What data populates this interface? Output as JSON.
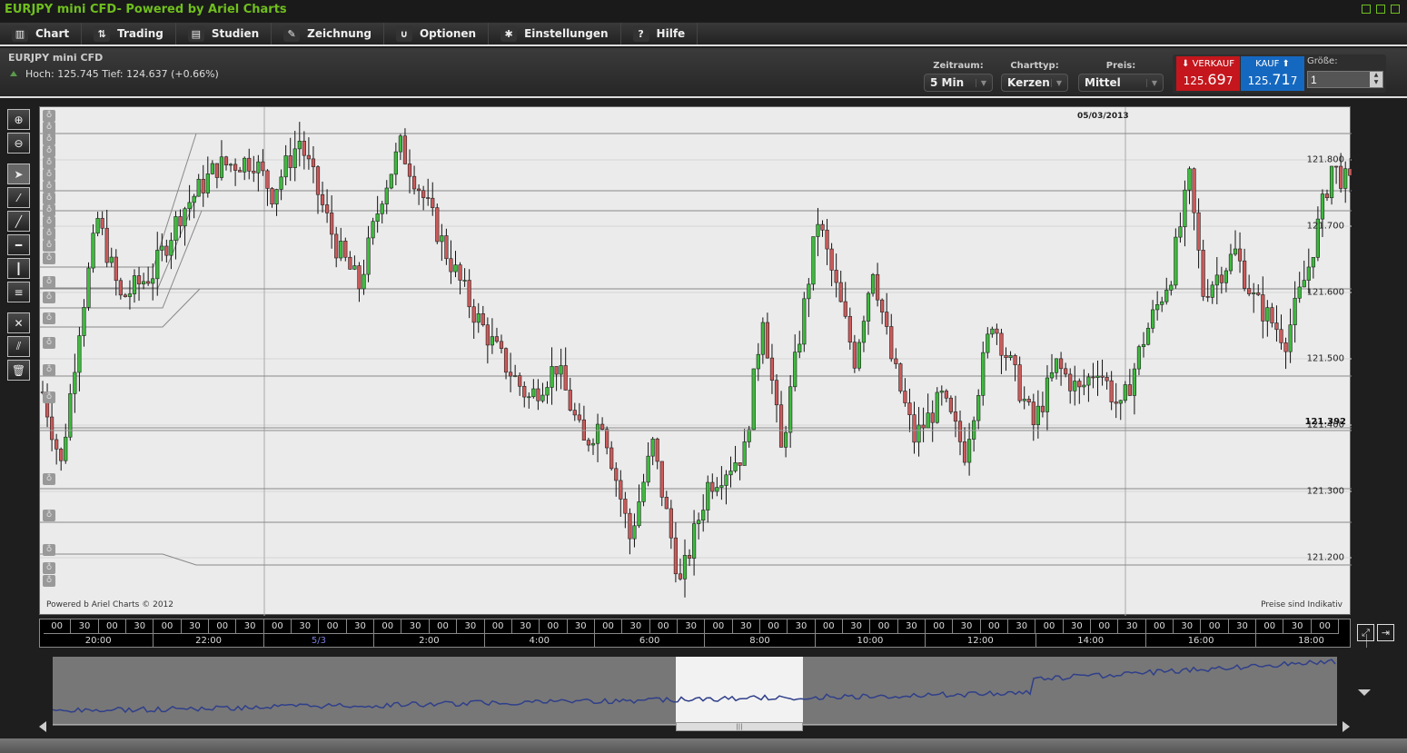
{
  "window": {
    "title": "EURJPY mini  CFD- Powered by Ariel Charts"
  },
  "menu": [
    {
      "label": "Chart",
      "icon": "bar-chart-icon",
      "glyph": "▥"
    },
    {
      "label": "Trading",
      "icon": "trade-arrows-icon",
      "glyph": "⇅"
    },
    {
      "label": "Studien",
      "icon": "studies-icon",
      "glyph": "▤"
    },
    {
      "label": "Zeichnung",
      "icon": "pencil-icon",
      "glyph": "✎"
    },
    {
      "label": "Optionen",
      "icon": "options-curve-icon",
      "glyph": "∪"
    },
    {
      "label": "Einstellungen",
      "icon": "tools-icon",
      "glyph": "✱"
    },
    {
      "label": "Hilfe",
      "icon": "help-icon",
      "glyph": "?"
    }
  ],
  "instrument": {
    "name": "EURJPY mini  CFD",
    "stats": "Hoch: 125.745 Tief: 124.637 (+0.66%)"
  },
  "controls": {
    "zeitraum": {
      "label": "Zeitraum:",
      "value": "5 Min"
    },
    "charttyp": {
      "label": "Charttyp:",
      "value": "Kerzen"
    },
    "preis": {
      "label": "Preis:",
      "value": "Mittel"
    }
  },
  "trade": {
    "sell_label": "VERKAUF",
    "sell_price_prefix": "125.",
    "sell_price_big": "69",
    "sell_price_suffix": "7",
    "buy_label": "KAUF",
    "buy_price_prefix": "125.",
    "buy_price_big": "71",
    "buy_price_suffix": "7",
    "size_label": "Größe:",
    "size_value": "1"
  },
  "colors": {
    "up": "#3dbb3d",
    "down": "#cc5a5a",
    "sell": "#c4161c",
    "buy": "#1568c0",
    "title": "#6fbf1e"
  },
  "chart": {
    "date_label": "05/03/2013",
    "current_price": "121.392",
    "price_labels": [
      "121.800",
      "121.700",
      "121.600",
      "121.500",
      "121.400",
      "121.300",
      "121.200"
    ],
    "powered": "Powered b Ariel Charts © 2012",
    "disclaimer": "Preise sind Indikativ",
    "price_path": [
      [
        0,
        121.45
      ],
      [
        4,
        121.34
      ],
      [
        8,
        121.55
      ],
      [
        12,
        121.71
      ],
      [
        17,
        121.59
      ],
      [
        24,
        121.63
      ],
      [
        30,
        121.72
      ],
      [
        38,
        121.79
      ],
      [
        46,
        121.8
      ],
      [
        50,
        121.75
      ],
      [
        56,
        121.83
      ],
      [
        64,
        121.67
      ],
      [
        69,
        121.61
      ],
      [
        74,
        121.75
      ],
      [
        78,
        121.82
      ],
      [
        82,
        121.76
      ],
      [
        88,
        121.66
      ],
      [
        94,
        121.57
      ],
      [
        100,
        121.5
      ],
      [
        106,
        121.44
      ],
      [
        112,
        121.49
      ],
      [
        118,
        121.37
      ],
      [
        122,
        121.41
      ],
      [
        128,
        121.23
      ],
      [
        133,
        121.37
      ],
      [
        139,
        121.16
      ],
      [
        145,
        121.31
      ],
      [
        153,
        121.36
      ],
      [
        157,
        121.57
      ],
      [
        161,
        121.36
      ],
      [
        169,
        121.71
      ],
      [
        177,
        121.5
      ],
      [
        181,
        121.64
      ],
      [
        185,
        121.5
      ],
      [
        190,
        121.38
      ],
      [
        196,
        121.44
      ],
      [
        201,
        121.36
      ],
      [
        207,
        121.56
      ],
      [
        211,
        121.49
      ],
      [
        216,
        121.4
      ],
      [
        221,
        121.49
      ],
      [
        226,
        121.45
      ],
      [
        230,
        121.49
      ],
      [
        235,
        121.42
      ],
      [
        240,
        121.53
      ],
      [
        246,
        121.63
      ],
      [
        250,
        121.77
      ],
      [
        253,
        121.6
      ],
      [
        260,
        121.66
      ],
      [
        264,
        121.59
      ],
      [
        271,
        121.53
      ],
      [
        276,
        121.64
      ],
      [
        281,
        121.79
      ],
      [
        285,
        121.76
      ]
    ]
  },
  "time_axis": {
    "minor": [
      "00",
      "30",
      "00",
      "30",
      "00",
      "30",
      "00",
      "30",
      "00",
      "30",
      "00",
      "30",
      "00",
      "30",
      "00",
      "30",
      "00",
      "30",
      "00",
      "30",
      "00",
      "30",
      "00",
      "30",
      "00",
      "30",
      "00",
      "30",
      "00",
      "30",
      "00",
      "30",
      "00",
      "30",
      "00",
      "30",
      "00",
      "30",
      "00",
      "30",
      "00",
      "30",
      "00",
      "30",
      "00",
      "30",
      "00"
    ],
    "major": [
      "20:00",
      "22:00",
      "5/3",
      "2:00",
      "4:00",
      "6:00",
      "8:00",
      "10:00",
      "12:00",
      "14:00",
      "16:00",
      "18:00"
    ]
  }
}
